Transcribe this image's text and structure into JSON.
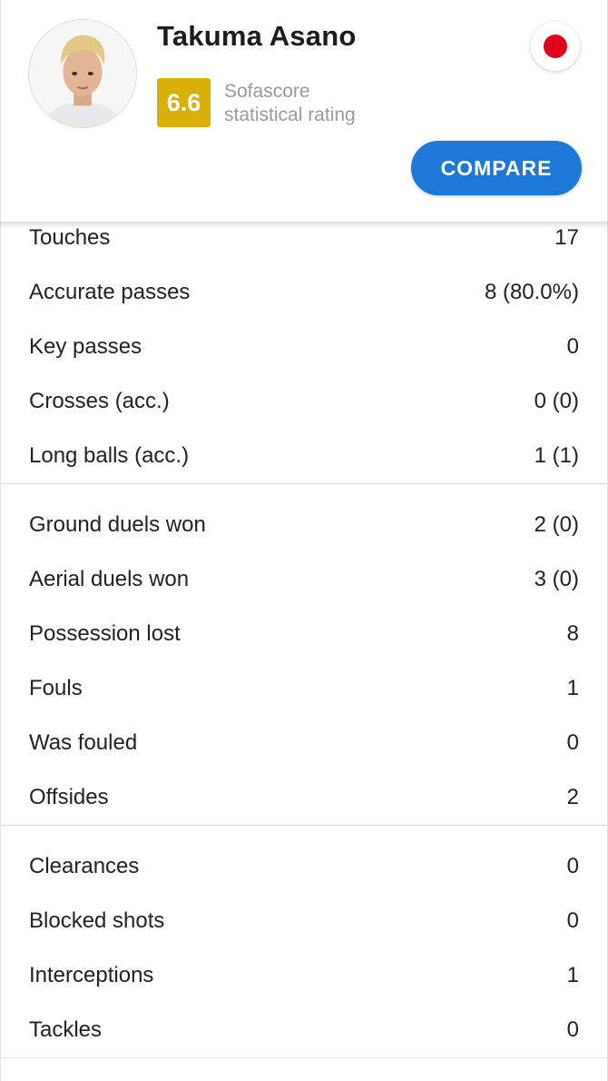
{
  "player": {
    "name": "Takuma Asano",
    "rating": "6.6",
    "rating_caption_line1": "Sofascore",
    "rating_caption_line2": "statistical rating",
    "flag_color": "#e0001b"
  },
  "actions": {
    "compare_label": "COMPARE"
  },
  "colors": {
    "rating_badge": "#d9b00a",
    "compare_button": "#1e78d8"
  },
  "stat_groups": [
    {
      "rows": [
        {
          "label": "Touches",
          "value": "17"
        },
        {
          "label": "Accurate passes",
          "value": "8 (80.0%)"
        },
        {
          "label": "Key passes",
          "value": "0"
        },
        {
          "label": "Crosses (acc.)",
          "value": "0 (0)"
        },
        {
          "label": "Long balls (acc.)",
          "value": "1 (1)"
        }
      ]
    },
    {
      "rows": [
        {
          "label": "Ground duels won",
          "value": "2 (0)"
        },
        {
          "label": "Aerial duels won",
          "value": "3 (0)"
        },
        {
          "label": "Possession lost",
          "value": "8"
        },
        {
          "label": "Fouls",
          "value": "1"
        },
        {
          "label": "Was fouled",
          "value": "0"
        },
        {
          "label": "Offsides",
          "value": "2"
        }
      ]
    },
    {
      "rows": [
        {
          "label": "Clearances",
          "value": "0"
        },
        {
          "label": "Blocked shots",
          "value": "0"
        },
        {
          "label": "Interceptions",
          "value": "1"
        },
        {
          "label": "Tackles",
          "value": "0"
        }
      ]
    }
  ]
}
